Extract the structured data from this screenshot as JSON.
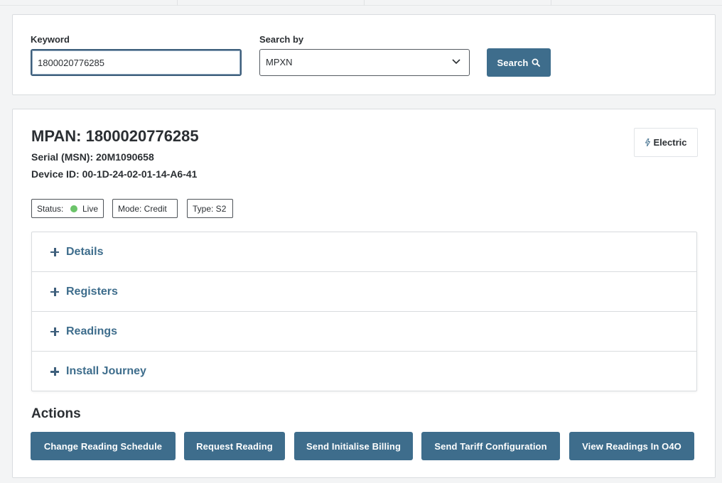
{
  "search": {
    "keyword_label": "Keyword",
    "keyword_value": "1800020776285",
    "search_by_label": "Search by",
    "search_by_value": "MPXN",
    "search_button": "Search"
  },
  "meter": {
    "title": "MPAN: 1800020776285",
    "serial": "Serial (MSN): 20M1090658",
    "device_id": "Device ID: 00-1D-24-02-01-14-A6-41",
    "fuel_badge": "Electric",
    "status_label": "Status:",
    "status_value": "Live",
    "mode": "Mode: Credit",
    "type": "Type: S2",
    "status_color": "#6cc46a"
  },
  "accordion": {
    "items": [
      {
        "label": "Details"
      },
      {
        "label": "Registers"
      },
      {
        "label": "Readings"
      },
      {
        "label": "Install Journey"
      }
    ]
  },
  "actions": {
    "title": "Actions",
    "buttons": [
      {
        "label": "Change Reading Schedule"
      },
      {
        "label": "Request Reading"
      },
      {
        "label": "Send Initialise Billing"
      },
      {
        "label": "Send Tariff Configuration"
      },
      {
        "label": "View Readings In O4O"
      }
    ]
  },
  "colors": {
    "accent": "#3e6d8c",
    "background": "#f3f4f5"
  }
}
